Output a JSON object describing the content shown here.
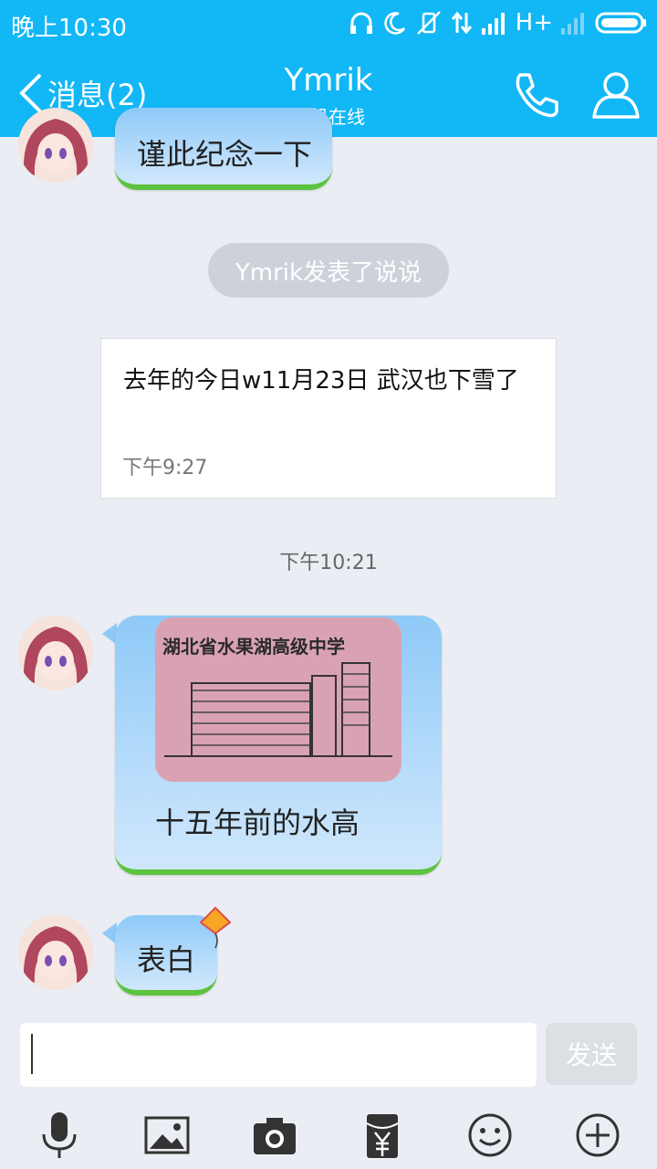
{
  "status_bar": {
    "time": "晚上10:30",
    "network": "H+"
  },
  "header": {
    "back_label": "消息(2)",
    "title": "Ymrik",
    "subtitle": "手机在线"
  },
  "messages": {
    "first_bubble": "谨此纪念一下",
    "system_pill": "Ymrik发表了说说",
    "post_card": {
      "content": "去年的今日w11月23日  武汉也下雪了",
      "time": "下午9:27"
    },
    "timestamp": "下午10:21",
    "photo_bubble": {
      "image_caption": "湖北省水果湖高级中学",
      "text": "十五年前的水高"
    },
    "last_bubble": "表白"
  },
  "input": {
    "placeholder": "",
    "send_label": "发送"
  },
  "toolbar": [
    "microphone-icon",
    "image-icon",
    "camera-icon",
    "red-packet-icon",
    "emoji-icon",
    "plus-icon"
  ],
  "colors": {
    "header_bg": "#12b7f5",
    "bubble_top": "#8ec9f7",
    "bubble_border": "#5cc33e",
    "chat_bg": "#eaedf3"
  }
}
